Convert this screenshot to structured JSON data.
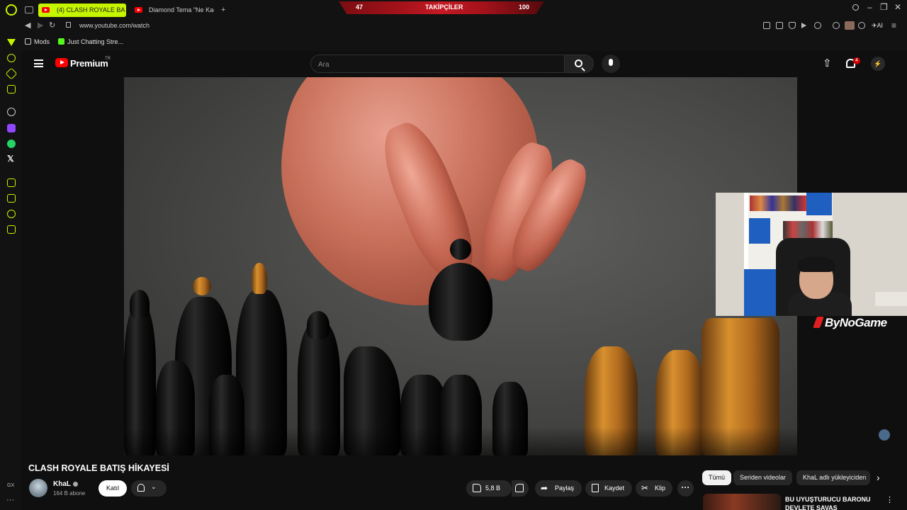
{
  "browser": {
    "tabs": [
      {
        "label": "(4) CLASH ROYALE BA",
        "active": true
      },
      {
        "label": "Diamond Tema \"Ne Kadar",
        "active": false
      }
    ],
    "new_tab_label": "+",
    "follower_bar": {
      "left_value": "47",
      "label": "TAKİPÇİLER",
      "right_value": "100"
    },
    "window_controls": [
      "–",
      "❐",
      "✕"
    ],
    "url": "www.youtube.com/watch",
    "ai_label": "AI",
    "bookmarks": [
      {
        "label": "Mods"
      },
      {
        "label": "Just Chatting Stre..."
      }
    ],
    "sidebar_footer": "GX",
    "sidebar_more": "···"
  },
  "youtube": {
    "brand": "Premium",
    "region": "TR",
    "search_placeholder": "Ara",
    "notification_count": "4",
    "avatar_glyph": "⚡"
  },
  "video": {
    "title": "CLASH ROYALE BATIŞ HİKAYESİ",
    "channel_watermark": "ByNoGame"
  },
  "channel": {
    "name": "KhaL",
    "subscribers": "164 B abone",
    "join_label": "Katıl"
  },
  "actions": {
    "likes": "5,8 B",
    "share": "Paylaş",
    "save": "Kaydet",
    "clip": "Klip",
    "more": "···"
  },
  "chips": [
    "Tümü",
    "Seriden videolar",
    "KhaL adlı yükleyiciden"
  ],
  "recommendation": {
    "title": "BU UYUŞTURUCU BARONU DEVLETE SAVAŞ AÇTI...PEKİ"
  }
}
